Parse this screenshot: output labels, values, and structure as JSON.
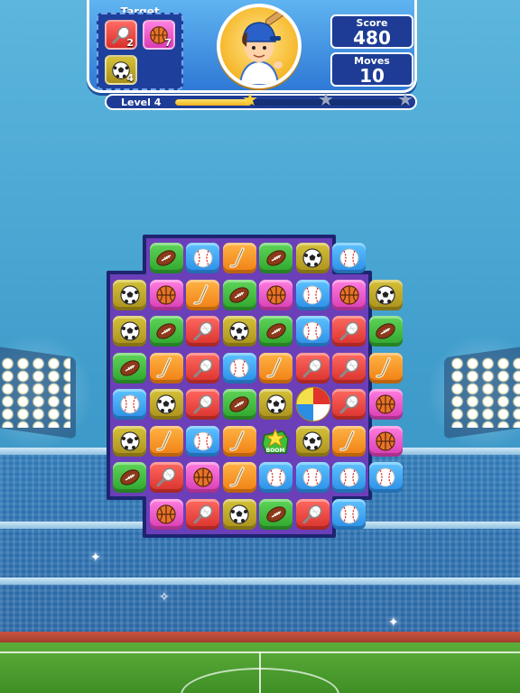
{
  "hud": {
    "target_label": "Target",
    "targets": [
      {
        "icon": "tennis-racket-icon",
        "color": "red",
        "count": "2"
      },
      {
        "icon": "basketball-icon",
        "color": "pink",
        "count": "7"
      },
      {
        "icon": "soccer-ball-icon",
        "color": "olive",
        "count": "4"
      }
    ],
    "score_label": "Score",
    "score_value": "480",
    "moves_label": "Moves",
    "moves_value": "10",
    "level_label": "Level 4",
    "progress": 0.33,
    "stars": [
      {
        "earned": true
      },
      {
        "earned": false
      },
      {
        "earned": false
      }
    ]
  },
  "board": {
    "rows": [
      [
        "",
        "green:football",
        "blue:baseball",
        "orange:hockey",
        "green:football",
        "olive:soccer",
        "blue:baseball",
        ""
      ],
      [
        "olive:soccer",
        "pink:basketball",
        "orange:hockey",
        "green:football",
        "pink:basketball",
        "blue:baseball",
        "pink:basketball",
        "olive:soccer"
      ],
      [
        "olive:soccer",
        "green:football",
        "red:tennis",
        "olive:soccer",
        "green:football",
        "blue:baseball",
        "red:tennis",
        "green:football"
      ],
      [
        "green:football",
        "orange:hockey",
        "red:tennis",
        "blue:baseball",
        "orange:hockey",
        "red:tennis",
        "red:tennis",
        "orange:hockey"
      ],
      [
        "blue:baseball",
        "olive:soccer",
        "red:tennis",
        "green:football",
        "olive:soccer",
        "special:beachball",
        "red:tennis",
        "pink:basketball"
      ],
      [
        "olive:soccer",
        "orange:hockey",
        "blue:baseball",
        "orange:hockey",
        "special:star",
        "olive:soccer",
        "orange:hockey",
        "pink:basketball"
      ],
      [
        "green:football",
        "red:tennis",
        "pink:basketball",
        "orange:hockey",
        "blue:baseball",
        "blue:baseball",
        "blue:baseball",
        "blue:baseball"
      ],
      [
        "",
        "pink:basketball",
        "red:tennis",
        "olive:soccer",
        "green:football",
        "red:tennis",
        "blue:baseball",
        ""
      ]
    ],
    "special_tile_text": "BOOM"
  }
}
